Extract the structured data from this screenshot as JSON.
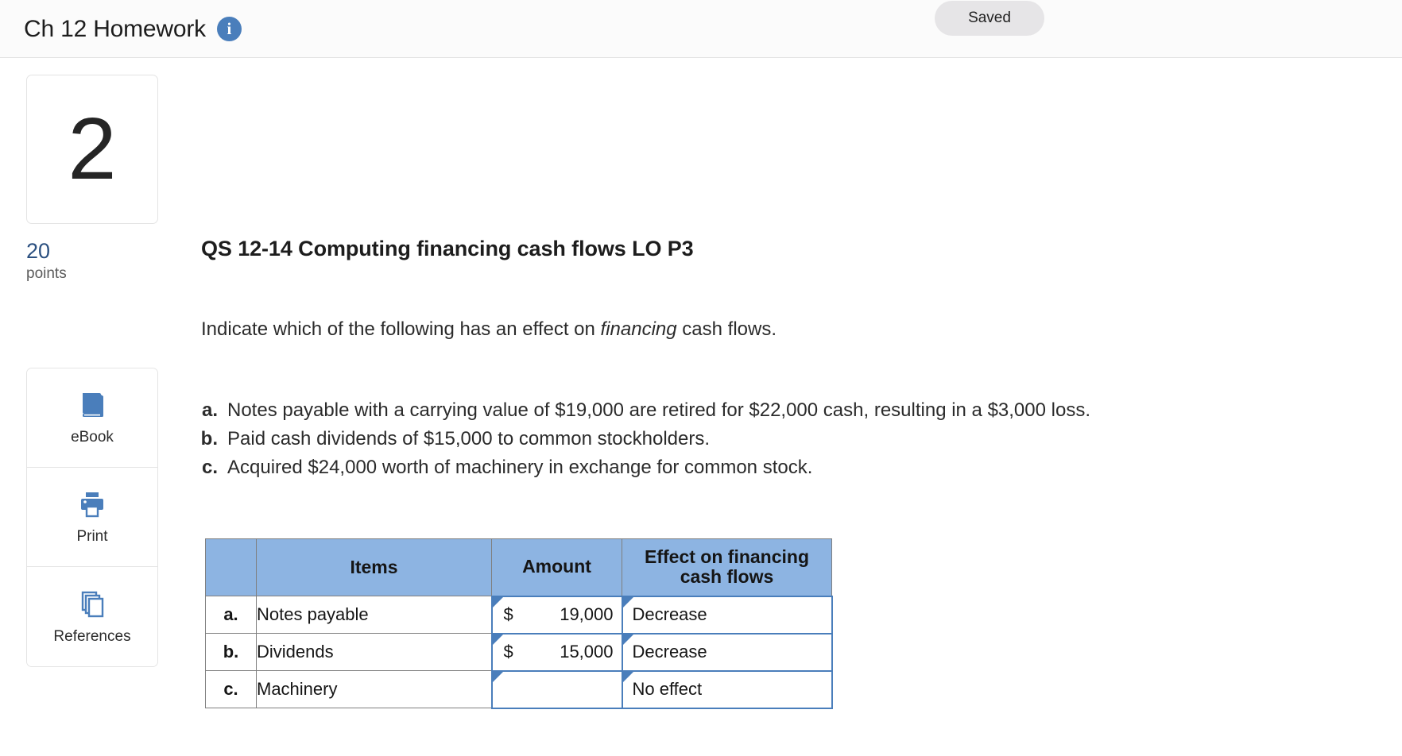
{
  "topbar": {
    "title": "Ch 12 Homework",
    "info_icon": "info-icon",
    "info_glyph": "i",
    "saved_label": "Saved"
  },
  "sidebar": {
    "question_number": "2",
    "points_value": "20",
    "points_label": "points",
    "tools": [
      {
        "label": "eBook",
        "icon": "ebook-icon"
      },
      {
        "label": "Print",
        "icon": "printer-icon"
      },
      {
        "label": "References",
        "icon": "references-icon"
      }
    ]
  },
  "question": {
    "title": "QS 12-14 Computing financing cash flows LO P3",
    "instruction_prefix": "Indicate which of the following has an effect on ",
    "instruction_emphasis": "financing",
    "instruction_suffix": " cash flows.",
    "items": [
      {
        "letter": "a.",
        "text": "Notes payable with a carrying value of $19,000 are retired for $22,000 cash, resulting in a $3,000 loss."
      },
      {
        "letter": "b.",
        "text": "Paid cash dividends of $15,000 to common stockholders."
      },
      {
        "letter": "c.",
        "text": "Acquired $24,000 worth of machinery in exchange for common stock."
      }
    ]
  },
  "answer_table": {
    "headers": {
      "letter": "",
      "items": "Items",
      "amount": "Amount",
      "effect_line1": "Effect on financing",
      "effect_line2": "cash flows"
    },
    "rows": [
      {
        "letter": "a.",
        "item": "Notes payable",
        "currency": "$",
        "amount": "19,000",
        "effect": "Decrease"
      },
      {
        "letter": "b.",
        "item": "Dividends",
        "currency": "$",
        "amount": "15,000",
        "effect": "Decrease"
      },
      {
        "letter": "c.",
        "item": "Machinery",
        "currency": "",
        "amount": "",
        "effect": "No effect"
      }
    ]
  },
  "colors": {
    "header_blue": "#8db4e2",
    "input_border": "#4a7ebb",
    "points_blue": "#2b5080",
    "saved_bg": "#e6e5e7"
  }
}
